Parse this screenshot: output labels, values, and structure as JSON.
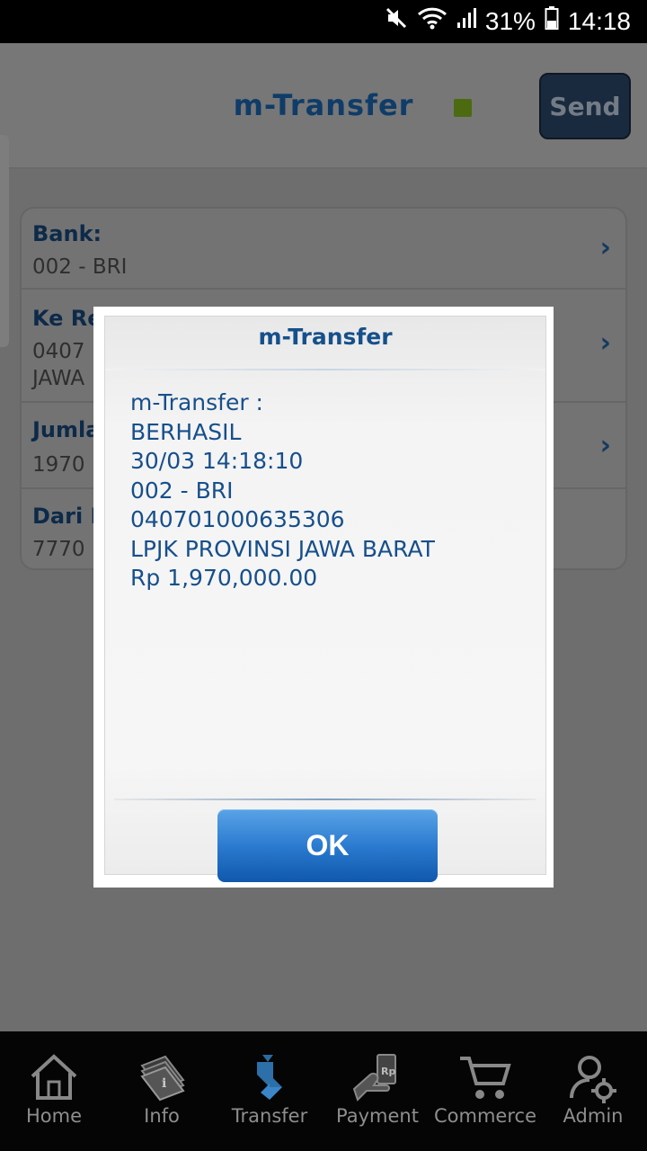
{
  "status_bar": {
    "battery": "31%",
    "time": "14:18"
  },
  "header": {
    "title": "m-Transfer",
    "send_label": "Send"
  },
  "form": {
    "rows": [
      {
        "label": "Bank:",
        "value": "002 - BRI",
        "value2": ""
      },
      {
        "label": "Ke Re",
        "value": "0407",
        "value2": "JAWA"
      },
      {
        "label": "Jumla",
        "value": "1970",
        "value2": ""
      },
      {
        "label": "Dari R",
        "value": "7770",
        "value2": ""
      }
    ]
  },
  "dialog": {
    "title": "m-Transfer",
    "lines": [
      "m-Transfer :",
      "BERHASIL",
      "30/03 14:18:10",
      "002 - BRI",
      "040701000635306",
      "LPJK PROVINSI JAWA BARAT",
      "Rp 1,970,000.00"
    ],
    "ok_label": "OK"
  },
  "bottom_nav": {
    "items": [
      {
        "label": "Home",
        "icon": "home-icon"
      },
      {
        "label": "Info",
        "icon": "info-icon"
      },
      {
        "label": "Transfer",
        "icon": "transfer-icon"
      },
      {
        "label": "Payment",
        "icon": "payment-icon"
      },
      {
        "label": "Commerce",
        "icon": "cart-icon"
      },
      {
        "label": "Admin",
        "icon": "admin-icon"
      }
    ]
  }
}
